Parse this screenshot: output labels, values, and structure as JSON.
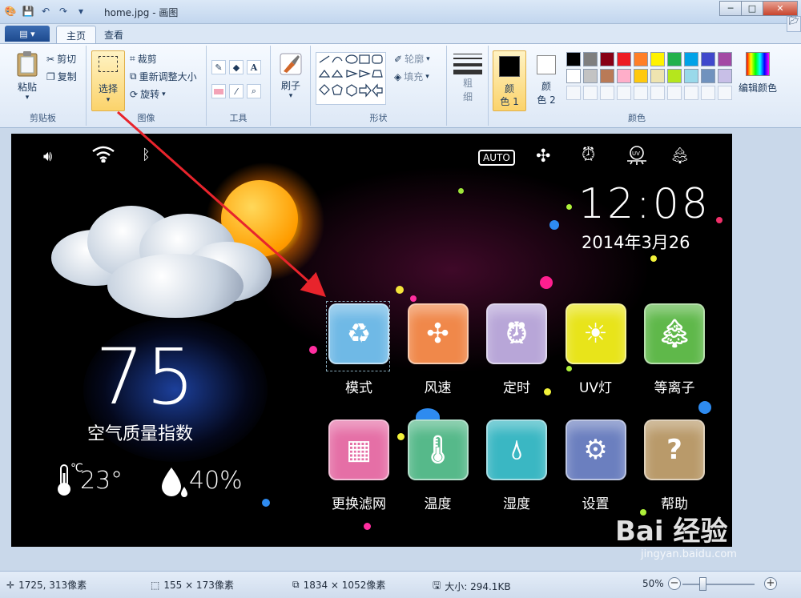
{
  "window": {
    "title": "home.jpg - 画图",
    "minimize": "─",
    "maximize": "□",
    "close": "✕"
  },
  "ribbon_tabs": {
    "file": "▤ ▾",
    "home": "主页",
    "view": "查看"
  },
  "clipboard": {
    "paste": "粘贴",
    "cut": "剪切",
    "copy": "复制",
    "group": "剪贴板"
  },
  "image_group": {
    "select": "选择",
    "crop": "裁剪",
    "resize": "重新调整大小",
    "rotate": "旋转",
    "group": "图像"
  },
  "tools_group": {
    "group": "工具"
  },
  "brushes": {
    "label": "刷子"
  },
  "shapes_group": {
    "outline": "轮廓",
    "fill": "填充",
    "group": "形状"
  },
  "size": {
    "label_top": "粗",
    "label_bottom": "细"
  },
  "colors_group": {
    "color1_top": "颜",
    "color1_bottom": "色 1",
    "color2_top": "颜",
    "color2_bottom": "色 2",
    "edit": "编辑颜色",
    "group": "颜色",
    "palette": [
      "#000000",
      "#7f7f7f",
      "#880015",
      "#ed1c24",
      "#ff7f27",
      "#fff200",
      "#22b14c",
      "#00a2e8",
      "#3f48cc",
      "#a349a4",
      "#ffffff",
      "#c3c3c3",
      "#b97a57",
      "#ffaec9",
      "#ffc90e",
      "#efe4b0",
      "#b5e61d",
      "#99d9ea",
      "#7092be",
      "#c8bfe7"
    ]
  },
  "device": {
    "status_auto": "AUTO",
    "time": "12:08",
    "date": "2014年3月26",
    "aqi_value": "75",
    "aqi_label": "空气质量指数",
    "temperature": "23°",
    "humidity": "40%",
    "temp_unit": "℃",
    "tiles": [
      {
        "label": "模式",
        "color": "#6fb9e6"
      },
      {
        "label": "风速",
        "color": "#f0884a"
      },
      {
        "label": "定时",
        "color": "#b8a6d8"
      },
      {
        "label": "UV灯",
        "color": "#e8e41a"
      },
      {
        "label": "等离子",
        "color": "#5fb84a"
      },
      {
        "label": "更换滤网",
        "color": "#e56fa6"
      },
      {
        "label": "温度",
        "color": "#56b98a"
      },
      {
        "label": "湿度",
        "color": "#3ab7c3"
      },
      {
        "label": "设置",
        "color": "#6b7fbf"
      },
      {
        "label": "帮助",
        "color": "#b99a6a"
      }
    ]
  },
  "statusbar": {
    "cursor": "1725, 313像素",
    "selection": "155 × 173像素",
    "image_size": "1834 × 1052像素",
    "file_size": "大小: 294.1KB",
    "zoom": "50%",
    "zoom_out": "−",
    "zoom_in": "+"
  },
  "watermark": {
    "main": "Bai 经验",
    "sub": "jingyan.baidu.com"
  }
}
